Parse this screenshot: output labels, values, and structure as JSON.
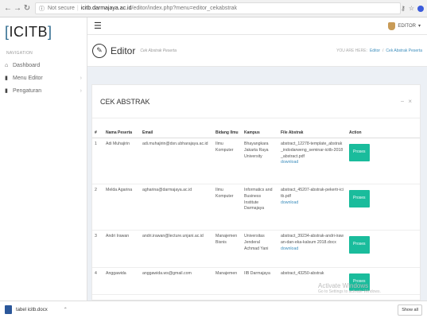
{
  "browser": {
    "not_secure": "Not secure",
    "domain": "icitb.darmajaya.ac.id",
    "path": "/editor/index.php?menu=editor_cekabstrak"
  },
  "sidebar": {
    "logo_open": "[",
    "logo_text": "ICITB",
    "logo_close": "]",
    "nav_header": "NAVIGATION",
    "items": [
      {
        "label": "Dashboard",
        "icon": "home-icon"
      },
      {
        "label": "Menu Editor",
        "icon": "file-icon"
      },
      {
        "label": "Pengaturan",
        "icon": "file-icon"
      }
    ]
  },
  "header": {
    "user": "EDITOR"
  },
  "titlebar": {
    "title": "Editor",
    "subtitle": "Cek Abstrak Peserta",
    "crumb_prefix": "YOU ARE HERE:",
    "crumb_1": "Editor",
    "crumb_sep": "/",
    "crumb_2": "Cek Abstrak Peserta"
  },
  "box": {
    "title": "CEK ABSTRAK",
    "tools": [
      "−",
      "×"
    ]
  },
  "table": {
    "headers": [
      "#",
      "Nama Peserta",
      "Email",
      "Bidang Ilmu",
      "Kampus",
      "File Abstrak",
      "Action"
    ],
    "rows": [
      {
        "no": "1",
        "nama": "Adi Muhajirin",
        "email": "adi.muhajirin@dsn.ubharajaya.ac.id",
        "bidang": "Ilmu Komputer",
        "kampus": "Bhayangkara Jakarta Raya University",
        "file": "abstract_12278-template_abstrak_indodarweng_seminar-icitb-2018_abstract.pdf",
        "download": "download",
        "action": "Proses"
      },
      {
        "no": "2",
        "nama": "Melda Agarina",
        "email": "agharina@darmajaya.ac.id",
        "bidang": "Ilmu Komputer",
        "kampus": "Informatics and Business Institute Darmajaya",
        "file": "abstract_45207-abstrak-pekertr-icitb.pdf",
        "download": "download",
        "action": "Proses"
      },
      {
        "no": "3",
        "nama": "Andri Irawan",
        "email": "andri.irawan@lecture.unjani.ac.id",
        "bidang": "Manajemen Bisnis",
        "kampus": "Universitas Jenderal Achmad Yani",
        "file": "abstract_39234-abstrak-andri-irawan-dan-eka-kalsum 2018.docx",
        "download": "download",
        "action": "Proses"
      },
      {
        "no": "4",
        "nama": "Anggawida",
        "email": "anggawida.ws@gmail.com",
        "bidang": "Manajemen",
        "kampus": "IIB Darmajaya",
        "file": "abstract_43250-abstrak",
        "download": "",
        "action": "Proses"
      }
    ]
  },
  "watermark": {
    "title": "Activate Windows",
    "sub": "Go to Settings to activate Windows."
  },
  "downloads": {
    "file": "tabel icitb.docx",
    "show_all": "Show all"
  }
}
